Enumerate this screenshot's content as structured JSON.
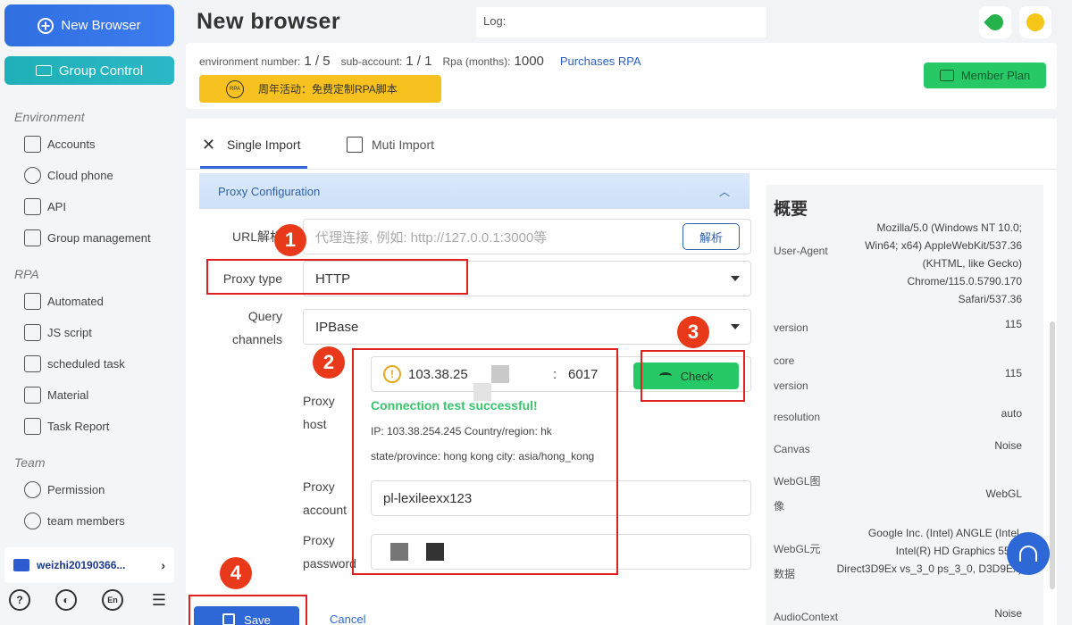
{
  "sidebar": {
    "new_browser": "New Browser",
    "group_control": "Group Control",
    "sections": [
      {
        "title": "Environment",
        "items": [
          "Accounts",
          "Cloud phone",
          "API",
          "Group management"
        ]
      },
      {
        "title": "RPA",
        "items": [
          "Automated",
          "JS script",
          "scheduled task",
          "Material",
          "Task Report"
        ]
      },
      {
        "title": "Team",
        "items": [
          "Permission",
          "team members"
        ]
      }
    ],
    "account_name": "weizhi20190366...",
    "bottom_icons": [
      "help-icon",
      "theme-icon",
      "language-icon",
      "menu-collapse-icon"
    ],
    "language_icon_text": "En"
  },
  "header": {
    "title": "New browser",
    "log_label": "Log:",
    "icons": [
      "rocket-icon",
      "lightbulb-icon"
    ]
  },
  "stats": {
    "env_label": "environment number:",
    "env_value": "1 / 5",
    "sub_label": "sub-account:",
    "sub_value": "1 / 1",
    "rpa_label": "Rpa (months):",
    "rpa_value": "1000",
    "purchase_link": "Purchases RPA",
    "promo_text": "周年活动：免费定制RPA脚本",
    "promo_icon_text": "RPA",
    "member_plan": "Member Plan"
  },
  "tabs": [
    {
      "label": "Single Import",
      "active": true
    },
    {
      "label": "Muti Import",
      "active": false
    }
  ],
  "proxy_section": {
    "title": "Proxy Configuration",
    "url_label": "URL解析",
    "url_placeholder": "代理连接, 例如: http://127.0.0.1:3000等",
    "parse_button": "解析",
    "proxy_type_label": "Proxy type",
    "proxy_type_value": "HTTP",
    "query_label_1": "Query",
    "query_label_2": "channels",
    "query_value": "IPBase",
    "host_label_1": "Proxy",
    "host_label_2": "host",
    "host_value": "103.38.25",
    "port_sep": ":",
    "port_value": "6017",
    "check_button": "Check",
    "result_title": "Connection test successful!",
    "result_line1": "IP: 103.38.254.245 Country/region: hk",
    "result_line2": "state/province: hong kong city: asia/hong_kong",
    "account_label_1": "Proxy",
    "account_label_2": "account",
    "account_value": "pl-lexileexx123",
    "password_label_1": "Proxy",
    "password_label_2": "password"
  },
  "annotations": [
    "1",
    "2",
    "3",
    "4"
  ],
  "actions": {
    "save": "Save",
    "cancel": "Cancel"
  },
  "overview": {
    "title": "概要",
    "rows": [
      {
        "key": "User-Agent",
        "value": "Mozilla/5.0 (Windows NT 10.0; Win64; x64) AppleWebKit/537.36 (KHTML, like Gecko) Chrome/115.0.5790.170 Safari/537.36"
      },
      {
        "key": "version",
        "value": "115"
      },
      {
        "key": "core version",
        "value": "115"
      },
      {
        "key": "resolution",
        "value": "auto"
      },
      {
        "key": "Canvas",
        "value": "Noise"
      },
      {
        "key": "WebGL图像",
        "value": "WebGL"
      },
      {
        "key": "WebGL元数据",
        "value": "Google Inc. (Intel) ANGLE (Intel, Intel(R) HD Graphics 5500 Direct3D9Ex vs_3_0 ps_3_0, D3D9Ex)"
      },
      {
        "key": "AudioContext",
        "value": "Noise"
      }
    ]
  }
}
